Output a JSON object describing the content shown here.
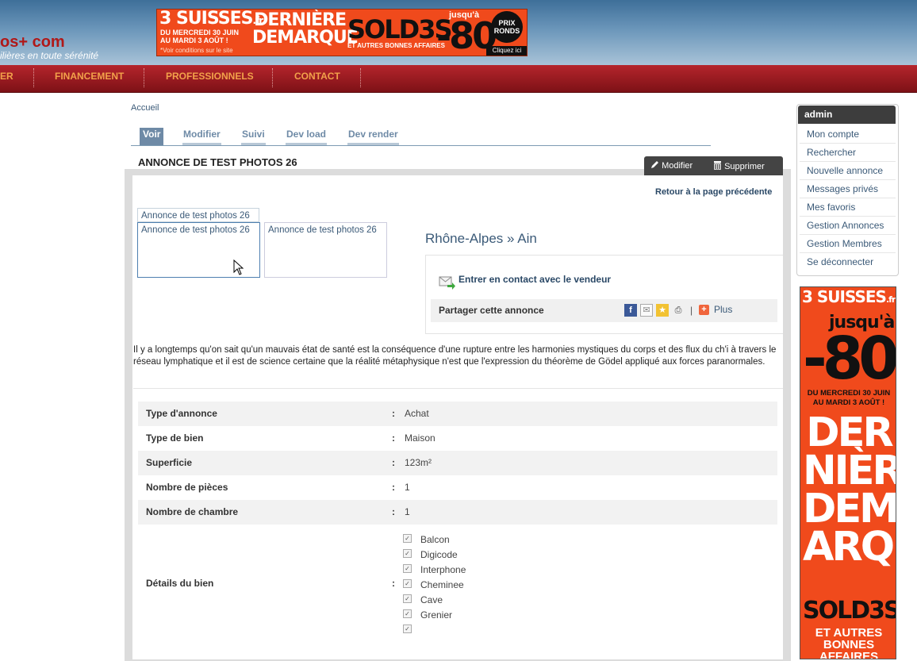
{
  "header": {
    "logo_text": "os+ com",
    "tagline": "ilières en toute sérénité"
  },
  "banner_top": {
    "brand": "3 SUISSES",
    "brand_suffix": ".fr",
    "dates": "DU MERCREDI 30 JUIN AU MARDI 3 AOÛT !",
    "conditions": "*Voir conditions sur le site",
    "headline": "DERNIÈRE DEMARQUE",
    "sold": "SOLD3S",
    "other": "ET AUTRES BONNES AFFAIRES",
    "jusqu": "jusqu'à",
    "percent": "-80",
    "percent_sign": "%",
    "prix": "PRIX RONDS",
    "click": "Cliquez ici"
  },
  "nav": {
    "items": [
      "ER",
      "FINANCEMENT",
      "PROFESSIONNELS",
      "CONTACT"
    ]
  },
  "breadcrumb": "Accueil",
  "tabs": [
    "Voir",
    "Modifier",
    "Suivi",
    "Dev load",
    "Dev render"
  ],
  "page_title": "ANNONCE DE TEST PHOTOS 26",
  "actions": {
    "modifier": "Modifier",
    "supprimer": "Supprimer"
  },
  "back_link": "Retour à la page précédente",
  "gallery": {
    "tab_label": "Annonce de test photos 26",
    "thumbs": [
      "Annonce de test photos 26",
      "Annonce de test photos 26"
    ]
  },
  "region": "Rhône-Alpes » Ain",
  "contact": {
    "link": "Entrer en contact avec le vendeur",
    "share_label": "Partager cette annonce",
    "separator": "|",
    "plus": "Plus"
  },
  "description": "Il y a longtemps qu'on sait qu'un mauvais état de santé est la conséquence d'une rupture entre les harmonies mystiques du corps et des flux du ch'i à travers le réseau lymphatique et il est de science certaine que la réalité métaphysique n'est que l'expression du théorème de Gödel appliqué aux forces paranormales.",
  "properties": [
    {
      "label": "Type d'annonce",
      "value": "Achat"
    },
    {
      "label": "Type de bien",
      "value": "Maison"
    },
    {
      "label": "Superficie",
      "value": "123m²"
    },
    {
      "label": "Nombre de pièces",
      "value": "1"
    },
    {
      "label": "Nombre de chambre",
      "value": "1"
    }
  ],
  "details": {
    "label": "Détails du bien",
    "features": [
      "Balcon",
      "Digicode",
      "Interphone",
      "Cheminee",
      "Cave",
      "Grenier",
      ""
    ]
  },
  "colon": ":",
  "sidebar": {
    "title": "admin",
    "links": [
      "Mon compte",
      "Rechercher",
      "Nouvelle annonce",
      "Messages privés",
      "Mes favoris",
      "Gestion Annonces",
      "Gestion Membres",
      "Se déconnecter"
    ]
  },
  "banner_side": {
    "brand": "3 SUISSES",
    "brand_suffix": ".fr",
    "jusqu": "jusqu'à",
    "percent": "-80",
    "percent_sign": "%",
    "dates": "DU MERCREDI 30 JUIN AU MARDI 3 AOÛT !",
    "headline": "DER NIÈRE DEM ARQUE",
    "sold": "SOLD3S",
    "other": "ET AUTRES BONNES AFFAIRES"
  },
  "colors": {
    "nav_bg": "#a01c22",
    "nav_text": "#f2a14a",
    "link": "#3b5a78",
    "banner": "#f04a1c"
  }
}
